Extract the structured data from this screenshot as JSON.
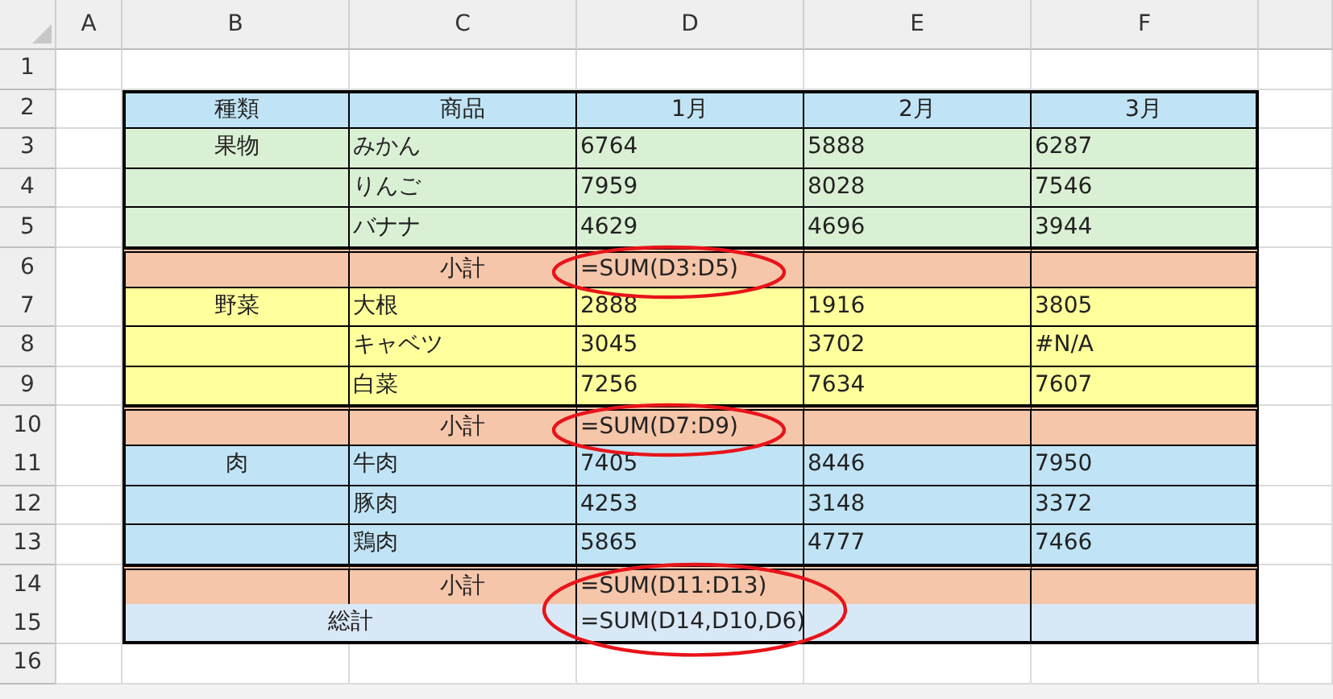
{
  "columns": [
    "A",
    "B",
    "C",
    "D",
    "E",
    "F"
  ],
  "rows": [
    {
      "number": "1",
      "kind": "blank"
    },
    {
      "number": "2",
      "kind": "header",
      "color": "#c0e4f5",
      "cells": {
        "B": "種類",
        "C": "商品",
        "D": "1月",
        "E": "2月",
        "F": "3月"
      }
    },
    {
      "number": "3",
      "kind": "item",
      "color": "#daf0d4",
      "cells": {
        "B": "果物",
        "C": "みかん",
        "D": "6764",
        "E": "5888",
        "F": "6287"
      }
    },
    {
      "number": "4",
      "kind": "item",
      "color": "#daf0d4",
      "cells": {
        "C": "りんご",
        "D": "7959",
        "E": "8028",
        "F": "7546"
      }
    },
    {
      "number": "5",
      "kind": "item",
      "color": "#daf0d4",
      "cells": {
        "C": "バナナ",
        "D": "4629",
        "E": "4696",
        "F": "3944"
      }
    },
    {
      "number": "6",
      "kind": "subtotal",
      "color": "#f5c6aa",
      "circled": true,
      "cells": {
        "C": "小計",
        "D": "=SUM(D3:D5)"
      }
    },
    {
      "number": "7",
      "kind": "item",
      "color": "#ffff9c",
      "cells": {
        "B": "野菜",
        "C": "大根",
        "D": "2888",
        "E": "1916",
        "F": "3805"
      }
    },
    {
      "number": "8",
      "kind": "item",
      "color": "#ffff9c",
      "cells": {
        "C": "キャベツ",
        "D": "3045",
        "E": "3702",
        "F": "#N/A"
      }
    },
    {
      "number": "9",
      "kind": "item",
      "color": "#ffff9c",
      "cells": {
        "C": "白菜",
        "D": "7256",
        "E": "7634",
        "F": "7607"
      }
    },
    {
      "number": "10",
      "kind": "subtotal",
      "color": "#f5c6aa",
      "circled": true,
      "cells": {
        "C": "小計",
        "D": "=SUM(D7:D9)"
      }
    },
    {
      "number": "11",
      "kind": "item",
      "color": "#c0e4f5",
      "cells": {
        "B": "肉",
        "C": "牛肉",
        "D": "7405",
        "E": "8446",
        "F": "7950"
      }
    },
    {
      "number": "12",
      "kind": "item",
      "color": "#c0e4f5",
      "cells": {
        "C": "豚肉",
        "D": "4253",
        "E": "3148",
        "F": "3372"
      }
    },
    {
      "number": "13",
      "kind": "item",
      "color": "#c0e4f5",
      "cells": {
        "C": "鶏肉",
        "D": "5865",
        "E": "4777",
        "F": "7466"
      }
    },
    {
      "number": "14",
      "kind": "subtotal",
      "color": "#f5c6aa",
      "circled": true,
      "cells": {
        "C": "小計",
        "D": "=SUM(D11:D13)"
      }
    },
    {
      "number": "15",
      "kind": "total",
      "color": "#d9e8f6",
      "circled": true,
      "cells": {
        "B": "総計",
        "D": "=SUM(D14,D10,D6)"
      }
    },
    {
      "number": "16",
      "kind": "blank"
    }
  ]
}
